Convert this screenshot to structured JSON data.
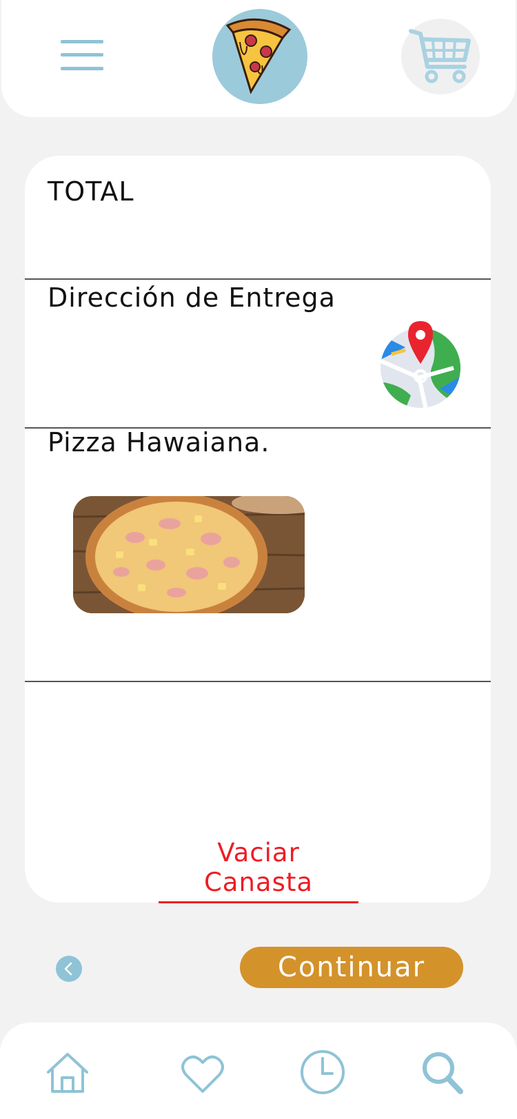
{
  "header": {
    "menu_icon": "hamburger-menu-icon",
    "logo_icon": "pizza-slice-logo",
    "cart_icon": "shopping-cart-icon"
  },
  "summary": {
    "total_label": "TOTAL",
    "delivery_label": "Dirección de Entrega",
    "delivery_icon": "map-pin-icon",
    "item_name": "Pizza Hawaiana.",
    "item_image": "hawaiian-pizza-photo",
    "empty_label": "Vaciar Canasta"
  },
  "actions": {
    "back_icon": "chevron-left-icon",
    "continue_label": "Continuar"
  },
  "bottom_nav": {
    "items": [
      {
        "icon": "home-icon"
      },
      {
        "icon": "heart-icon"
      },
      {
        "icon": "clock-icon"
      },
      {
        "icon": "search-icon"
      }
    ]
  },
  "colors": {
    "accent_blue": "#8fc3d6",
    "accent_orange": "#d4922b",
    "danger_red": "#ee1c24",
    "background": "#f2f2f2"
  }
}
